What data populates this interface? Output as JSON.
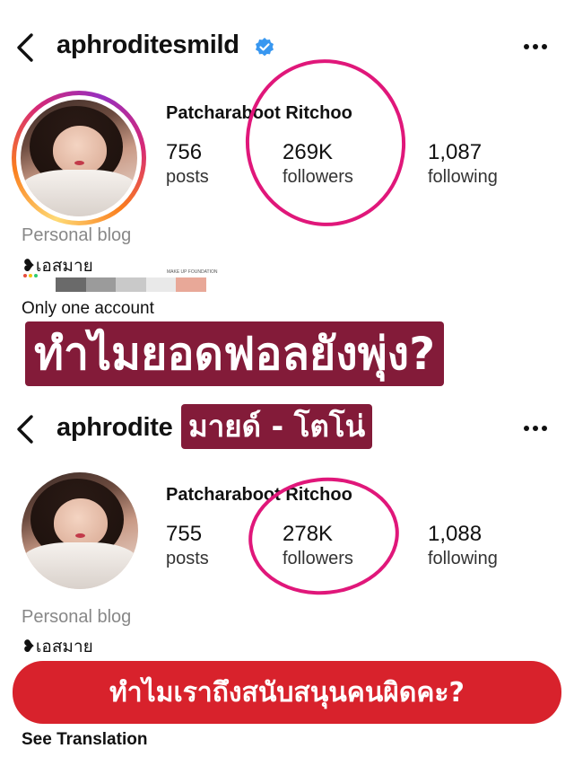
{
  "top_profile": {
    "username": "aphroditesmild",
    "full_name": "Patcharaboot Ritchoo",
    "stats": [
      {
        "value": "756",
        "label": "posts"
      },
      {
        "value": "269K",
        "label": "followers"
      },
      {
        "value": "1,087",
        "label": "following"
      }
    ],
    "bio_category": "Personal blog",
    "bio_line": "❥เอสมาย",
    "bio_extra": "Only one account",
    "mini_label": "MAKE UP FOUNDATION"
  },
  "headline": {
    "main": "ทำไมยอดฟอลยังพุ่ง?",
    "sub": "มายด์ - โตโน่"
  },
  "bottom_profile": {
    "username": "aphrodite",
    "full_name": "Patcharaboot Ritchoo",
    "stats": [
      {
        "value": "755",
        "label": "posts"
      },
      {
        "value": "278K",
        "label": "followers"
      },
      {
        "value": "1,088",
        "label": "following"
      }
    ],
    "bio_category": "Personal blog",
    "bio_line": "❥เอสมาย"
  },
  "banner": {
    "text": "ทำไมเราถึงสนับสนุนคนผิดคะ?"
  },
  "see_translation": "See Translation",
  "colors": {
    "highlight_circle": "#e0177a",
    "headline_bg": "#780828",
    "banner_bg": "#d8222c",
    "verified": "#3897f0"
  }
}
